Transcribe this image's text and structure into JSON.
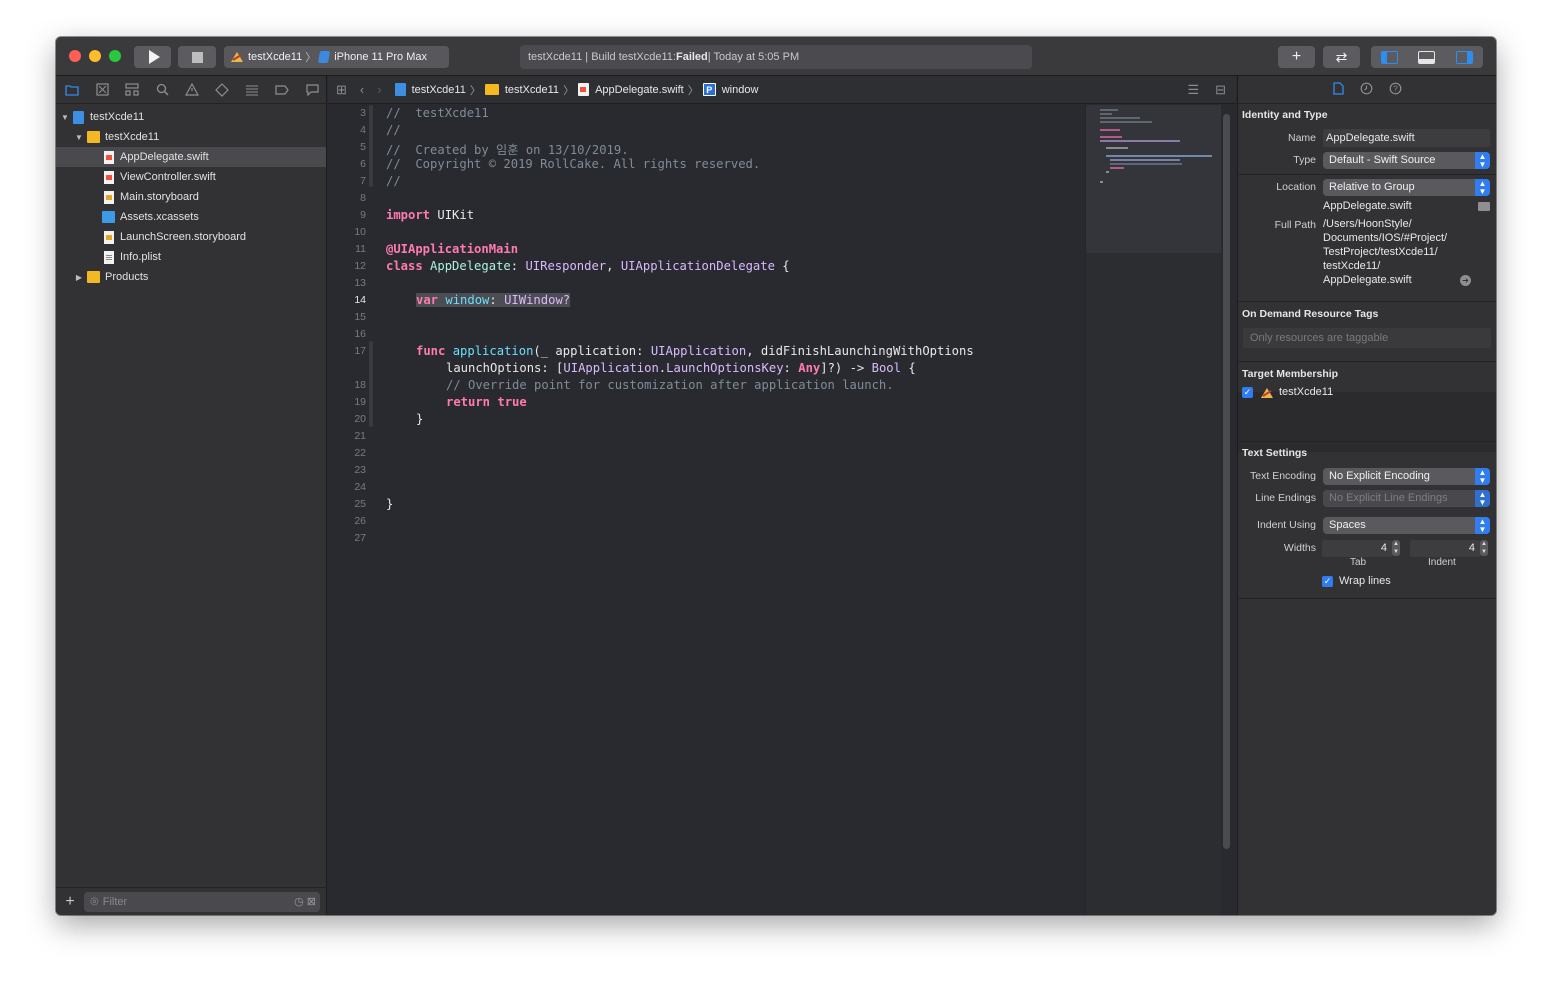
{
  "toolbar": {
    "scheme_project": "testXcde11",
    "scheme_device": "iPhone 11 Pro Max",
    "status_prefix": "testXcde11 | Build testXcde11: ",
    "status_result": "Failed",
    "status_suffix": " | Today at 5:05 PM",
    "add_label": "+",
    "swap_label": "⇄"
  },
  "navigator": {
    "project": "testXcde11",
    "group": "testXcde11",
    "files": [
      "AppDelegate.swift",
      "ViewController.swift",
      "Main.storyboard",
      "Assets.xcassets",
      "LaunchScreen.storyboard",
      "Info.plist"
    ],
    "products": "Products",
    "filter_placeholder": "Filter"
  },
  "jumpbar": {
    "project": "testXcde11",
    "group": "testXcde11",
    "file": "AppDelegate.swift",
    "symbol_badge": "P",
    "symbol": "window"
  },
  "editor": {
    "line_numbers": [
      "3",
      "4",
      "5",
      "6",
      "7",
      "8",
      "9",
      "10",
      "11",
      "12",
      "13",
      "14",
      "15",
      "16",
      "17",
      "",
      "18",
      "19",
      "20",
      "21",
      "22",
      "23",
      "24",
      "25",
      "26",
      "27"
    ],
    "current_line": "14",
    "code": {
      "l3": "//  testXcde11",
      "l4": "//",
      "l5": "//  Created by 임훈 on 13/10/2019.",
      "l6": "//  Copyright © 2019 RollCake. All rights reserved.",
      "l7": "//",
      "l9_kw": "import",
      "l9_rest": " UIKit",
      "l11": "@UIApplicationMain",
      "l12_kw": "class",
      "l12_name": "AppDelegate",
      "l12_colon": ": ",
      "l12_t1": "UIResponder",
      "l12_comma": ", ",
      "l12_t2": "UIApplicationDelegate",
      "l12_brace": " {",
      "l14_kw": "var",
      "l14_name": "window",
      "l14_colon": ": ",
      "l14_type": "UIWindow?",
      "l17_kw": "func",
      "l17_name": "application",
      "l17_a": "(_ application: ",
      "l17_t1": "UIApplication",
      "l17_b": ", didFinishLaunchingWithOptions",
      "l17c_a": "launchOptions: [",
      "l17c_t1": "UIApplication",
      "l17c_dot": ".",
      "l17c_t2": "LaunchOptionsKey",
      "l17c_colon": ": ",
      "l17c_any": "Any",
      "l17c_b": "]?) -> ",
      "l17c_bool": "Bool",
      "l17c_brace": " {",
      "l18": "// Override point for customization after application launch.",
      "l19_kw": "return",
      "l19_val": "true",
      "l20": "}",
      "l25": "}"
    }
  },
  "inspector": {
    "identity_title": "Identity and Type",
    "name_label": "Name",
    "name_value": "AppDelegate.swift",
    "type_label": "Type",
    "type_value": "Default - Swift Source",
    "location_label": "Location",
    "location_value": "Relative to Group",
    "location_file": "AppDelegate.swift",
    "full_path_label": "Full Path",
    "full_path_lines": [
      "/Users/HoonStyle/",
      "Documents/IOS/#Project/",
      "TestProject/testXcde11/",
      "testXcde11/",
      "AppDelegate.swift"
    ],
    "odr_title": "On Demand Resource Tags",
    "odr_placeholder": "Only resources are taggable",
    "target_title": "Target Membership",
    "target_name": "testXcde11",
    "text_title": "Text Settings",
    "encoding_label": "Text Encoding",
    "encoding_value": "No Explicit Encoding",
    "line_endings_label": "Line Endings",
    "line_endings_value": "No Explicit Line Endings",
    "indent_label": "Indent Using",
    "indent_value": "Spaces",
    "widths_label": "Widths",
    "tab_width": "4",
    "indent_width": "4",
    "tab_label": "Tab",
    "indent_sub_label": "Indent",
    "wrap_label": "Wrap lines"
  }
}
